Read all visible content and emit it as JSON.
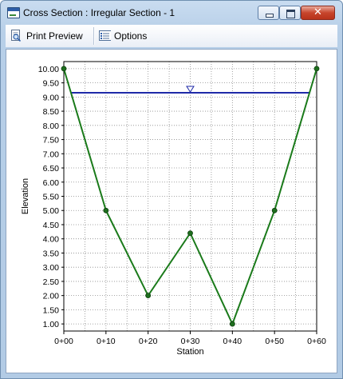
{
  "window": {
    "title": "Cross Section : Irregular Section - 1",
    "close_glyph": "✕"
  },
  "toolbar": {
    "print_preview_label": "Print Preview",
    "options_label": "Options"
  },
  "icons": {
    "app": "cross-section-window-icon",
    "print_preview": "print-preview-icon",
    "options": "options-list-icon",
    "minimize": "minimize-icon",
    "maximize": "maximize-icon",
    "close": "close-icon"
  },
  "colors": {
    "profile_line": "#1a7a1a",
    "profile_points": "#1e6e1e",
    "water_surface": "#1f2aa8",
    "grid": "#8c8c8c",
    "close_button": "#c7452c"
  },
  "chart_data": {
    "type": "line",
    "title": "",
    "xlabel": "Station",
    "ylabel": "Elevation",
    "x_ticks": [
      "0+00",
      "0+10",
      "0+20",
      "0+30",
      "0+40",
      "0+50",
      "0+60"
    ],
    "y_ticks": [
      "1.00",
      "1.50",
      "2.00",
      "2.50",
      "3.00",
      "3.50",
      "4.00",
      "4.50",
      "5.00",
      "5.50",
      "6.00",
      "6.50",
      "7.00",
      "7.50",
      "8.00",
      "8.50",
      "9.00",
      "9.50",
      "10.00"
    ],
    "xlim": [
      0,
      60
    ],
    "ylim": [
      0.75,
      10.25
    ],
    "grid": true,
    "series": [
      {
        "x": [
          0,
          10,
          20,
          30,
          40,
          50,
          60
        ],
        "y": [
          10.0,
          5.0,
          2.0,
          4.2,
          1.0,
          5.0,
          10.0
        ]
      }
    ],
    "water_surface": {
      "elevation": 9.15,
      "marker_station": 30
    }
  }
}
